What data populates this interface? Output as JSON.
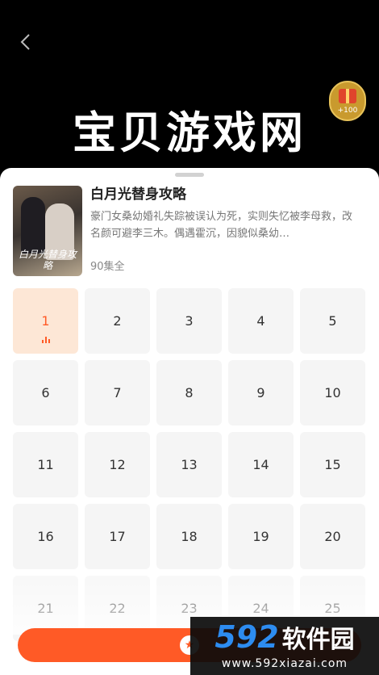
{
  "header": {
    "back_icon": "chevron-left-icon",
    "banner_text": "宝贝游戏网",
    "reward_amount": "+100"
  },
  "drama": {
    "title": "白月光替身攻略",
    "description": "豪门女桑幼婚礼失踪被误认为死，实则失忆被李母救，改名颜可避李三木。偶遇霍沉，因貌似桑幼…",
    "episode_count": "90集全",
    "cover_title": "白月光替身攻略"
  },
  "episodes": [
    "1",
    "2",
    "3",
    "4",
    "5",
    "6",
    "7",
    "8",
    "9",
    "10",
    "11",
    "12",
    "13",
    "14",
    "15",
    "16",
    "17",
    "18",
    "19",
    "20",
    "21",
    "22",
    "23",
    "24",
    "25"
  ],
  "active_episode": "1",
  "cta": {
    "icon": "star-icon"
  },
  "watermark": {
    "number": "592",
    "brand": "软件园",
    "url": "www.592xiazai.com"
  },
  "colors": {
    "accent": "#ff5a26",
    "active_bg": "#fde7d6",
    "tile_bg": "#f5f5f5"
  }
}
